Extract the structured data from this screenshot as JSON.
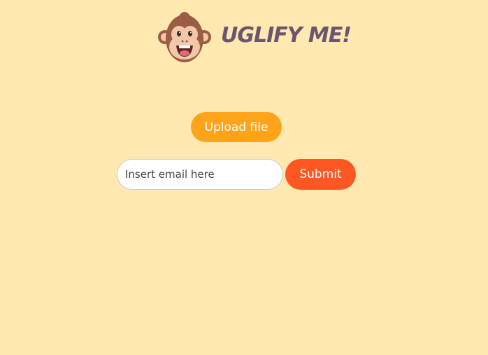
{
  "header": {
    "logo_icon": "monkey-face-icon",
    "brand_name": "UGLIFY ME!"
  },
  "upload": {
    "label": "Upload file"
  },
  "email": {
    "value": "",
    "placeholder": "Insert email here"
  },
  "submit": {
    "label": "Submit"
  },
  "colors": {
    "background": "#ffe9b0",
    "upload_button": "#ffa31a",
    "submit_button": "#ff5722",
    "brand_text": "#6a5670"
  }
}
